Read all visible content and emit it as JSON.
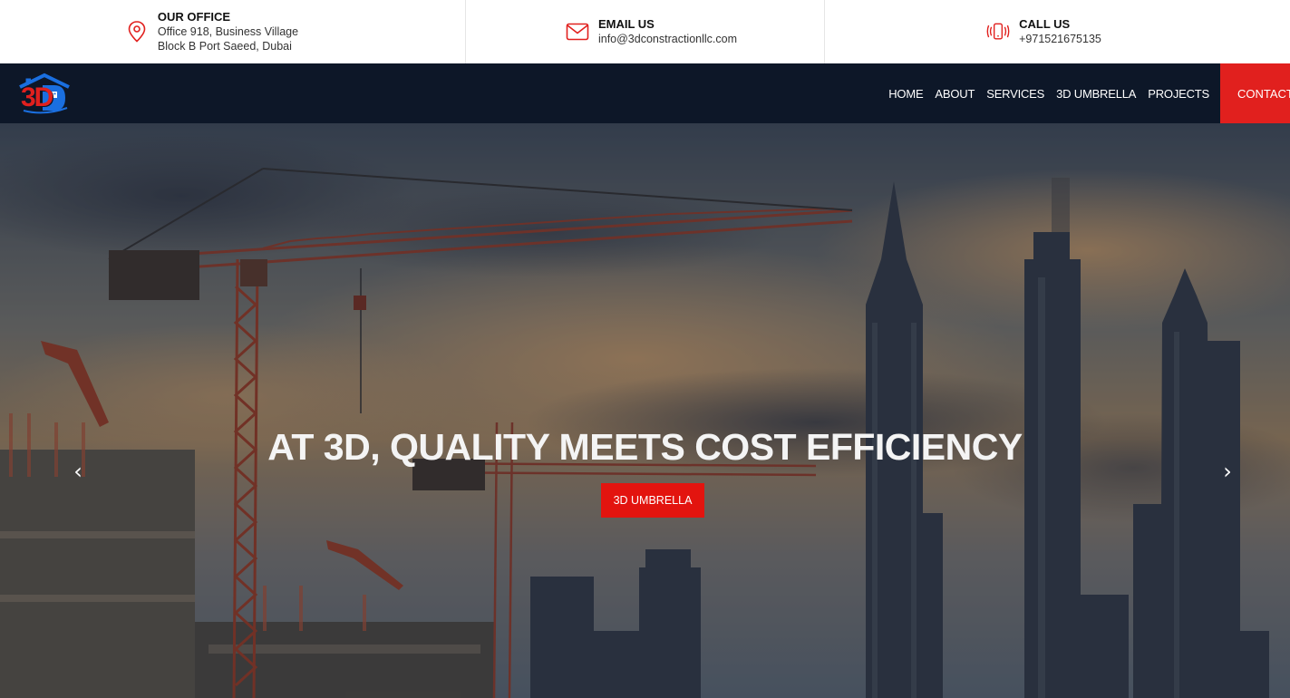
{
  "topbar": {
    "office": {
      "heading": "OUR OFFICE",
      "line1": "Office 918, Business Village",
      "line2": "Block B Port Saeed, Dubai",
      "icon": "location-pin-icon"
    },
    "email": {
      "heading": "EMAIL US",
      "line1": "info@3dconstractionllc.com",
      "icon": "envelope-icon"
    },
    "call": {
      "heading": "CALL US",
      "line1": "+971521675135",
      "icon": "vibrating-phone-icon"
    }
  },
  "nav": {
    "logo_text": "3D",
    "links": [
      "HOME",
      "ABOUT",
      "SERVICES",
      "3D UMBRELLA",
      "PROJECTS"
    ],
    "contact": "CONTACT"
  },
  "hero": {
    "title": "AT 3D, QUALITY MEETS COST EFFICIENCY",
    "button": "3D UMBRELLA",
    "prev_arrow": "‹",
    "next_arrow": "›"
  },
  "colors": {
    "accent": "#e1201e",
    "nav_bg": "#0d1728",
    "logo_blue": "#1a6fe0"
  }
}
